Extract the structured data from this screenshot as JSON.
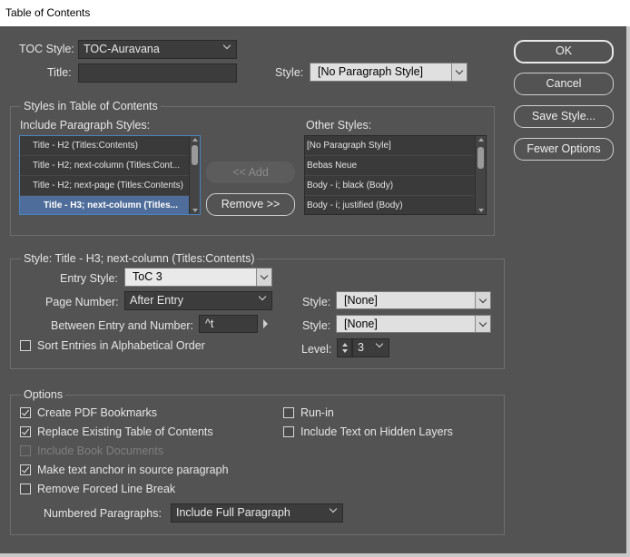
{
  "window": {
    "title": "Table of Contents"
  },
  "buttons": {
    "ok": "OK",
    "cancel": "Cancel",
    "save_style": "Save Style...",
    "fewer_options": "Fewer Options",
    "add": "<< Add",
    "remove": "Remove >>"
  },
  "toc_style": {
    "label": "TOC Style:",
    "value": "TOC-Auravana"
  },
  "title": {
    "label": "Title:",
    "value": ""
  },
  "title_style": {
    "label": "Style:",
    "value": "[No Paragraph Style]"
  },
  "styles_in_toc": {
    "heading": "Styles in Table of Contents",
    "include_label": "Include Paragraph Styles:",
    "include_items": [
      "Title - H2 (Titles:Contents)",
      "Title - H2; next-column (Titles:Cont...",
      "Title - H2; next-page (Titles:Contents)",
      "Title - H3; next-column (Titles..."
    ],
    "selected_index": 3,
    "other_label": "Other Styles:",
    "other_items": [
      "[No Paragraph Style]",
      "Bebas Neue",
      "Body - i; black (Body)",
      "Body - i; justified (Body)"
    ]
  },
  "style_section": {
    "heading": "Style: Title - H3; next-column (Titles:Contents)",
    "entry_style_label": "Entry Style:",
    "entry_style_value": "ToC 3",
    "page_number_label": "Page Number:",
    "page_number_value": "After Entry",
    "page_number_style_label": "Style:",
    "page_number_style_value": "[None]",
    "between_label": "Between Entry and Number:",
    "between_value": "^t",
    "between_style_label": "Style:",
    "between_style_value": "[None]",
    "sort_label": "Sort Entries in Alphabetical Order",
    "sort_checked": false,
    "level_label": "Level:",
    "level_value": "3"
  },
  "options": {
    "heading": "Options",
    "create_pdf_bookmarks": {
      "label": "Create PDF Bookmarks",
      "checked": true
    },
    "replace_existing": {
      "label": "Replace Existing Table of Contents",
      "checked": true
    },
    "include_book_documents": {
      "label": "Include Book Documents",
      "checked": false,
      "disabled": true
    },
    "make_text_anchor": {
      "label": "Make text anchor in source paragraph",
      "checked": true
    },
    "remove_forced_line_break": {
      "label": "Remove Forced Line Break",
      "checked": false
    },
    "run_in": {
      "label": "Run-in",
      "checked": false
    },
    "include_hidden_layers": {
      "label": "Include Text on Hidden Layers",
      "checked": false
    },
    "numbered_paragraphs_label": "Numbered Paragraphs:",
    "numbered_paragraphs_value": "Include Full Paragraph"
  }
}
